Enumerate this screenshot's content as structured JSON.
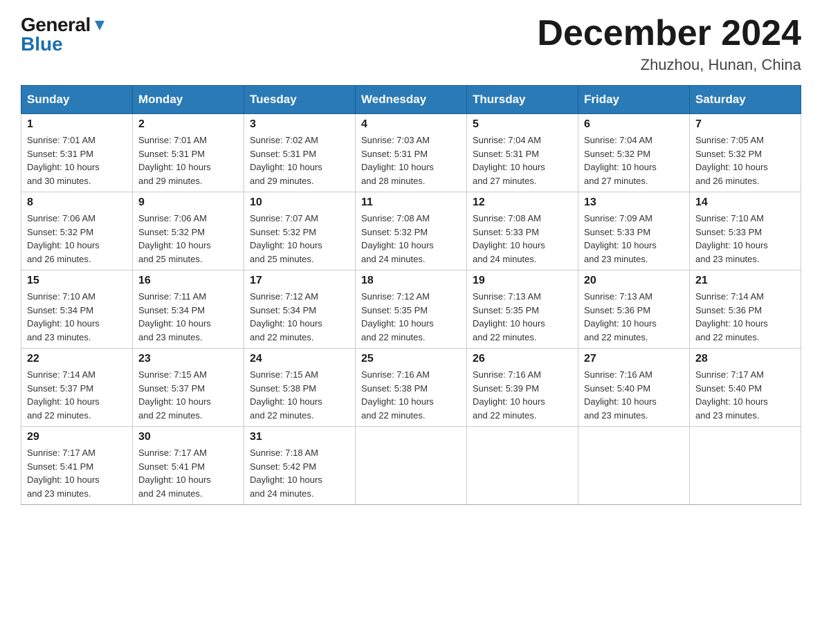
{
  "logo": {
    "general": "General",
    "blue": "Blue"
  },
  "header": {
    "month_year": "December 2024",
    "location": "Zhuzhou, Hunan, China"
  },
  "weekdays": [
    "Sunday",
    "Monday",
    "Tuesday",
    "Wednesday",
    "Thursday",
    "Friday",
    "Saturday"
  ],
  "weeks": [
    [
      {
        "day": "1",
        "sunrise": "7:01 AM",
        "sunset": "5:31 PM",
        "daylight": "10 hours and 30 minutes."
      },
      {
        "day": "2",
        "sunrise": "7:01 AM",
        "sunset": "5:31 PM",
        "daylight": "10 hours and 29 minutes."
      },
      {
        "day": "3",
        "sunrise": "7:02 AM",
        "sunset": "5:31 PM",
        "daylight": "10 hours and 29 minutes."
      },
      {
        "day": "4",
        "sunrise": "7:03 AM",
        "sunset": "5:31 PM",
        "daylight": "10 hours and 28 minutes."
      },
      {
        "day": "5",
        "sunrise": "7:04 AM",
        "sunset": "5:31 PM",
        "daylight": "10 hours and 27 minutes."
      },
      {
        "day": "6",
        "sunrise": "7:04 AM",
        "sunset": "5:32 PM",
        "daylight": "10 hours and 27 minutes."
      },
      {
        "day": "7",
        "sunrise": "7:05 AM",
        "sunset": "5:32 PM",
        "daylight": "10 hours and 26 minutes."
      }
    ],
    [
      {
        "day": "8",
        "sunrise": "7:06 AM",
        "sunset": "5:32 PM",
        "daylight": "10 hours and 26 minutes."
      },
      {
        "day": "9",
        "sunrise": "7:06 AM",
        "sunset": "5:32 PM",
        "daylight": "10 hours and 25 minutes."
      },
      {
        "day": "10",
        "sunrise": "7:07 AM",
        "sunset": "5:32 PM",
        "daylight": "10 hours and 25 minutes."
      },
      {
        "day": "11",
        "sunrise": "7:08 AM",
        "sunset": "5:32 PM",
        "daylight": "10 hours and 24 minutes."
      },
      {
        "day": "12",
        "sunrise": "7:08 AM",
        "sunset": "5:33 PM",
        "daylight": "10 hours and 24 minutes."
      },
      {
        "day": "13",
        "sunrise": "7:09 AM",
        "sunset": "5:33 PM",
        "daylight": "10 hours and 23 minutes."
      },
      {
        "day": "14",
        "sunrise": "7:10 AM",
        "sunset": "5:33 PM",
        "daylight": "10 hours and 23 minutes."
      }
    ],
    [
      {
        "day": "15",
        "sunrise": "7:10 AM",
        "sunset": "5:34 PM",
        "daylight": "10 hours and 23 minutes."
      },
      {
        "day": "16",
        "sunrise": "7:11 AM",
        "sunset": "5:34 PM",
        "daylight": "10 hours and 23 minutes."
      },
      {
        "day": "17",
        "sunrise": "7:12 AM",
        "sunset": "5:34 PM",
        "daylight": "10 hours and 22 minutes."
      },
      {
        "day": "18",
        "sunrise": "7:12 AM",
        "sunset": "5:35 PM",
        "daylight": "10 hours and 22 minutes."
      },
      {
        "day": "19",
        "sunrise": "7:13 AM",
        "sunset": "5:35 PM",
        "daylight": "10 hours and 22 minutes."
      },
      {
        "day": "20",
        "sunrise": "7:13 AM",
        "sunset": "5:36 PM",
        "daylight": "10 hours and 22 minutes."
      },
      {
        "day": "21",
        "sunrise": "7:14 AM",
        "sunset": "5:36 PM",
        "daylight": "10 hours and 22 minutes."
      }
    ],
    [
      {
        "day": "22",
        "sunrise": "7:14 AM",
        "sunset": "5:37 PM",
        "daylight": "10 hours and 22 minutes."
      },
      {
        "day": "23",
        "sunrise": "7:15 AM",
        "sunset": "5:37 PM",
        "daylight": "10 hours and 22 minutes."
      },
      {
        "day": "24",
        "sunrise": "7:15 AM",
        "sunset": "5:38 PM",
        "daylight": "10 hours and 22 minutes."
      },
      {
        "day": "25",
        "sunrise": "7:16 AM",
        "sunset": "5:38 PM",
        "daylight": "10 hours and 22 minutes."
      },
      {
        "day": "26",
        "sunrise": "7:16 AM",
        "sunset": "5:39 PM",
        "daylight": "10 hours and 22 minutes."
      },
      {
        "day": "27",
        "sunrise": "7:16 AM",
        "sunset": "5:40 PM",
        "daylight": "10 hours and 23 minutes."
      },
      {
        "day": "28",
        "sunrise": "7:17 AM",
        "sunset": "5:40 PM",
        "daylight": "10 hours and 23 minutes."
      }
    ],
    [
      {
        "day": "29",
        "sunrise": "7:17 AM",
        "sunset": "5:41 PM",
        "daylight": "10 hours and 23 minutes."
      },
      {
        "day": "30",
        "sunrise": "7:17 AM",
        "sunset": "5:41 PM",
        "daylight": "10 hours and 24 minutes."
      },
      {
        "day": "31",
        "sunrise": "7:18 AM",
        "sunset": "5:42 PM",
        "daylight": "10 hours and 24 minutes."
      },
      null,
      null,
      null,
      null
    ]
  ],
  "labels": {
    "sunrise": "Sunrise:",
    "sunset": "Sunset:",
    "daylight": "Daylight:"
  }
}
